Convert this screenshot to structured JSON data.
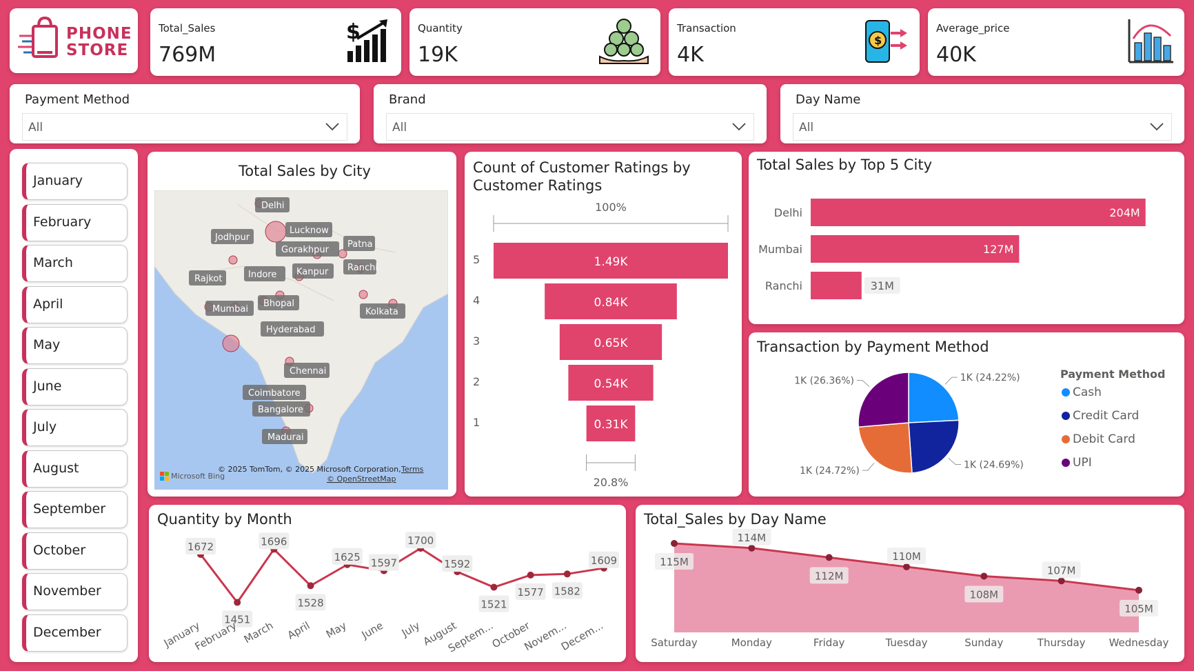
{
  "logo": {
    "line1": "PHONE",
    "line2": "STORE"
  },
  "kpis": [
    {
      "label": "Total_Sales",
      "value": "769M",
      "icon": "dollar-growth-icon"
    },
    {
      "label": "Quantity",
      "value": "19K",
      "icon": "coins-hand-icon"
    },
    {
      "label": "Transaction",
      "value": "4K",
      "icon": "phone-payment-icon"
    },
    {
      "label": "Average_price",
      "value": "40K",
      "icon": "bar-chart-icon"
    }
  ],
  "slicers": [
    {
      "title": "Payment Method",
      "value": "All"
    },
    {
      "title": "Brand",
      "value": "All"
    },
    {
      "title": "Day Name",
      "value": "All"
    }
  ],
  "months": [
    "January",
    "February",
    "March",
    "April",
    "May",
    "June",
    "July",
    "August",
    "September",
    "October",
    "November",
    "December"
  ],
  "map": {
    "title": "Total Sales by City",
    "cities": [
      "Delhi",
      "Jodhpur",
      "Lucknow",
      "Gorakhpur",
      "Patna",
      "Ranchi",
      "Kanpur",
      "Indore",
      "Rajkot",
      "Bhopal",
      "Mumbai",
      "Kolkata",
      "Hyderabad",
      "Chennai",
      "Coimbatore",
      "Bangalore",
      "Madurai"
    ],
    "attribution": "© 2025 TomTom, © 2025 Microsoft Corporation,",
    "terms": "Terms",
    "osm": "© OpenStreetMap",
    "bing": "Microsoft Bing"
  },
  "colors": {
    "accent": "#e0436c",
    "bar": "#e0436c",
    "line": "#c8374f",
    "cash": "#118dff",
    "credit": "#12239e",
    "debit": "#e66c37",
    "upi": "#6b007b"
  },
  "chart_data": [
    {
      "type": "bar",
      "subtype": "funnel",
      "title": "Count of Customer Ratings by Customer Ratings",
      "top_label": "100%",
      "bottom_label": "20.8%",
      "categories": [
        "5",
        "4",
        "3",
        "2",
        "1"
      ],
      "values": [
        1490,
        840,
        650,
        540,
        310
      ],
      "data_labels": [
        "1.49K",
        "0.84K",
        "0.65K",
        "0.54K",
        "0.31K"
      ]
    },
    {
      "type": "bar",
      "orientation": "horizontal",
      "title": "Total Sales by Top 5 City",
      "categories": [
        "Delhi",
        "Mumbai",
        "Ranchi"
      ],
      "values": [
        204,
        127,
        31
      ],
      "data_labels": [
        "204M",
        "127M",
        "31M"
      ],
      "xlim": [
        0,
        210
      ]
    },
    {
      "type": "pie",
      "title": "Transaction by Payment Method",
      "legend_title": "Payment Method",
      "legend_position": "right",
      "labels": [
        "Cash",
        "Credit Card",
        "Debit Card",
        "UPI"
      ],
      "values": [
        24.22,
        24.69,
        24.72,
        26.36
      ],
      "data_labels": [
        "1K (24.22%)",
        "1K (24.69%)",
        "1K (24.72%)",
        "1K (26.36%)"
      ]
    },
    {
      "type": "line",
      "title": "Quantity by Month",
      "categories": [
        "January",
        "February",
        "March",
        "April",
        "May",
        "June",
        "July",
        "August",
        "Septem...",
        "October",
        "Novem...",
        "Decem..."
      ],
      "values": [
        1672,
        1451,
        1696,
        1528,
        1625,
        1597,
        1700,
        1592,
        1521,
        1577,
        1582,
        1609
      ],
      "ylim": [
        1440,
        1710
      ]
    },
    {
      "type": "area",
      "title": "Total_Sales by Day Name",
      "categories": [
        "Saturday",
        "Monday",
        "Friday",
        "Tuesday",
        "Sunday",
        "Thursday",
        "Wednesday"
      ],
      "values": [
        115,
        114,
        112,
        110,
        108,
        107,
        105
      ],
      "data_labels": [
        "115M",
        "114M",
        "112M",
        "110M",
        "108M",
        "107M",
        "105M"
      ],
      "ylim": [
        96,
        115
      ]
    }
  ]
}
